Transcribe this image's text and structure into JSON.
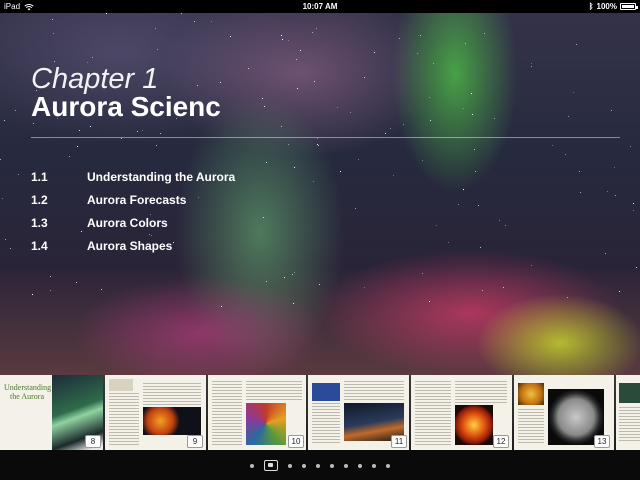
{
  "status_bar": {
    "device": "iPad",
    "time": "10:07 AM",
    "battery": "100%",
    "battery_level": 1.0
  },
  "chapter": {
    "label": "Chapter 1",
    "title": "Aurora Scienc"
  },
  "toc": [
    {
      "number": "1.1",
      "title": "Understanding the Aurora"
    },
    {
      "number": "1.2",
      "title": "Aurora Forecasts"
    },
    {
      "number": "1.3",
      "title": "Aurora Colors"
    },
    {
      "number": "1.4",
      "title": "Aurora Shapes"
    }
  ],
  "thumbnails": {
    "cover_title": "Understanding the Aurora",
    "pages": [
      "8",
      "9",
      "10",
      "11",
      "12",
      "13"
    ]
  },
  "page_dots": {
    "count": 10,
    "active_index": 1
  }
}
